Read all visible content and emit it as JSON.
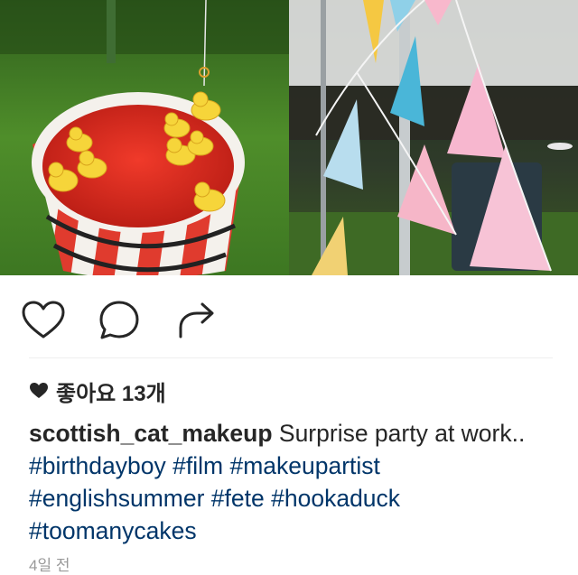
{
  "post": {
    "likes_label": "좋아요 13개",
    "username": "scottish_cat_makeup",
    "caption_text": " Surprise party at work.. ",
    "hashtags": [
      "#birthdayboy",
      "#film",
      "#makeupartist",
      "#englishsummer",
      "#fete",
      "#hookaduck",
      "#toomanycakes"
    ],
    "timestamp": "4일 전"
  },
  "icons": {
    "like": "heart-outline-icon",
    "comment": "comment-bubble-icon",
    "share": "share-arrow-icon",
    "likes_heart": "heart-filled-icon"
  },
  "colors": {
    "text": "#262626",
    "hashtag": "#003569",
    "timestamp": "#999999"
  }
}
